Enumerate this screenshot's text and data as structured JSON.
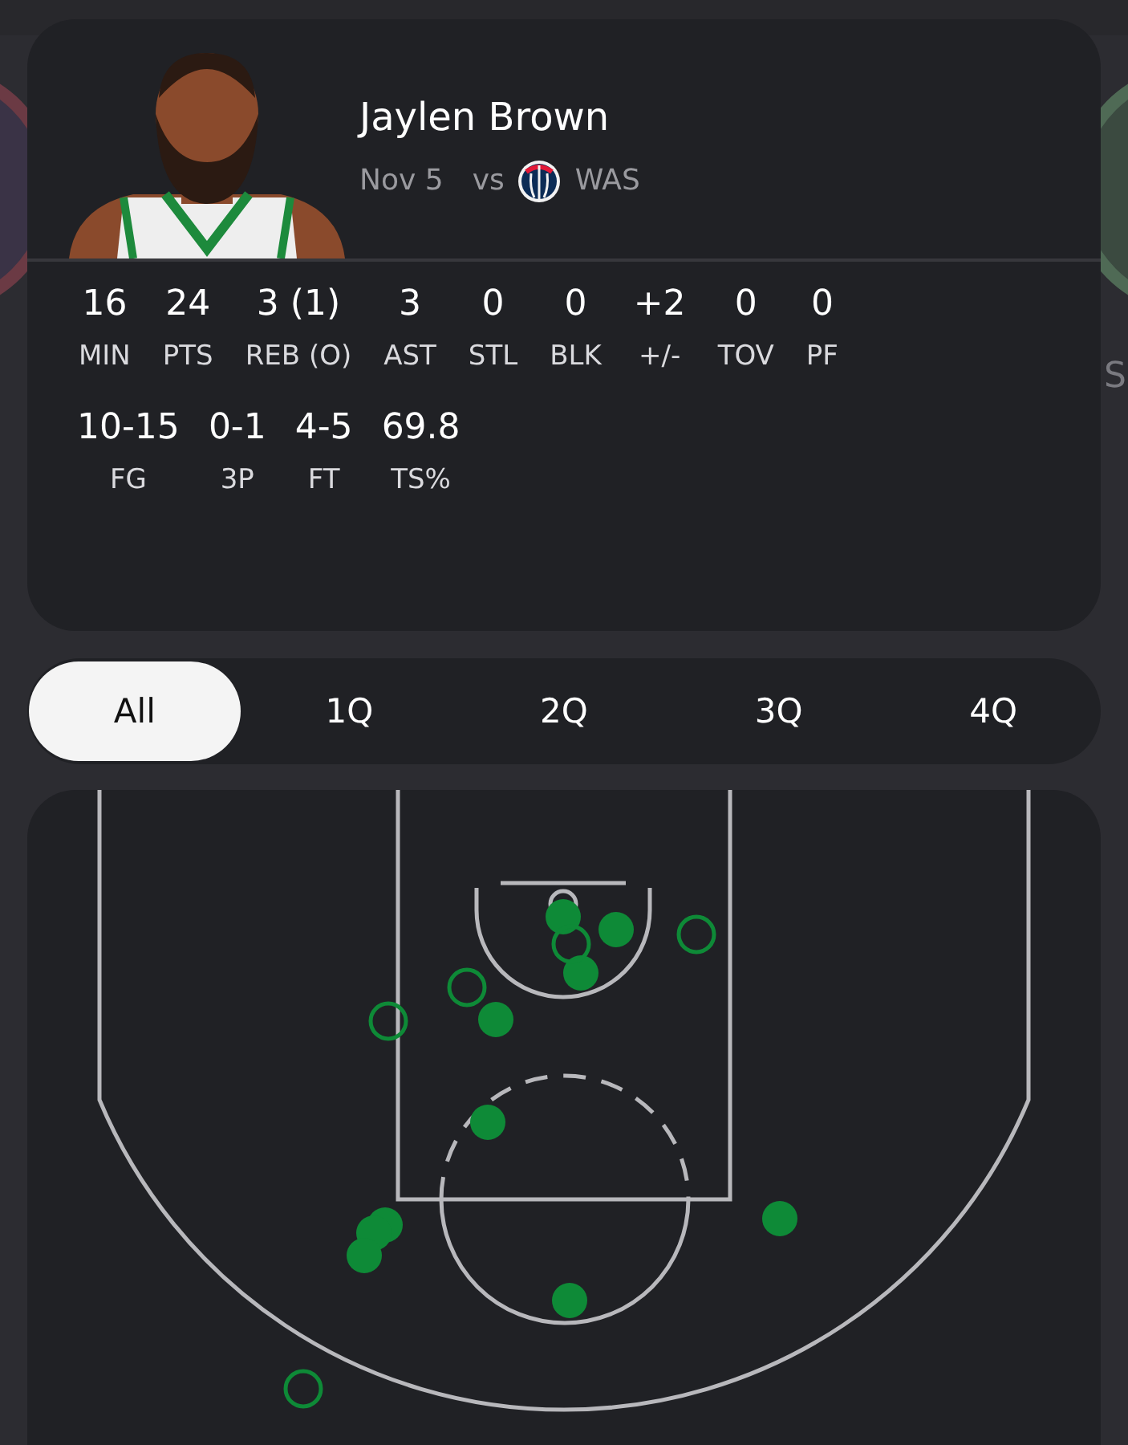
{
  "background": {
    "edge_text": "S"
  },
  "player": {
    "name": "Jaylen Brown",
    "date": "Nov 5",
    "vs": "vs",
    "opponent": "WAS"
  },
  "stats": [
    [
      {
        "value": "16",
        "label": "MIN"
      },
      {
        "value": "24",
        "label": "PTS"
      },
      {
        "value": "3 (1)",
        "label": "REB (O)"
      },
      {
        "value": "3",
        "label": "AST"
      },
      {
        "value": "0",
        "label": "STL"
      },
      {
        "value": "0",
        "label": "BLK"
      },
      {
        "value": "+2",
        "label": "+/-"
      },
      {
        "value": "0",
        "label": "TOV"
      },
      {
        "value": "0",
        "label": "PF"
      }
    ],
    [
      {
        "value": "10-15",
        "label": "FG"
      },
      {
        "value": "0-1",
        "label": "3P"
      },
      {
        "value": "4-5",
        "label": "FT"
      },
      {
        "value": "69.8",
        "label": "TS%"
      }
    ]
  ],
  "tabs": [
    {
      "label": "All",
      "selected": true
    },
    {
      "label": "1Q",
      "selected": false
    },
    {
      "label": "2Q",
      "selected": false
    },
    {
      "label": "3Q",
      "selected": false
    },
    {
      "label": "4Q",
      "selected": false
    }
  ],
  "shots": [
    {
      "made": true
    },
    {
      "made": true
    },
    {
      "made": true
    },
    {
      "made": true
    },
    {
      "made": true
    },
    {
      "made": true
    },
    {
      "made": true
    },
    {
      "made": true
    },
    {
      "made": true
    },
    {
      "made": true
    },
    {
      "made": false
    },
    {
      "made": false
    },
    {
      "made": false
    },
    {
      "made": false
    },
    {
      "made": false
    }
  ]
}
